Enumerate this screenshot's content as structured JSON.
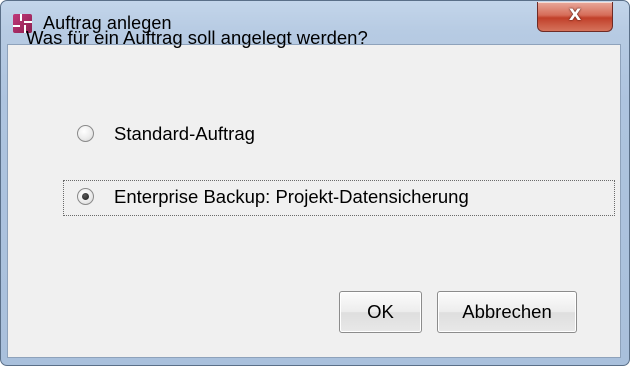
{
  "window": {
    "title": "Auftrag anlegen",
    "close_glyph": "X",
    "icon": "app-logo-icon"
  },
  "dialog": {
    "question": "Was für ein Auftrag soll angelegt werden?",
    "options": [
      {
        "label": "Standard-Auftrag",
        "selected": false
      },
      {
        "label": "Enterprise Backup: Projekt-Datensicherung",
        "selected": true,
        "focused": true
      }
    ]
  },
  "buttons": {
    "ok_label": "OK",
    "cancel_label": "Abbrechen"
  },
  "colors": {
    "frame": "#aec4df",
    "close_button": "#c1402a",
    "content_bg": "#f0f0f0"
  }
}
